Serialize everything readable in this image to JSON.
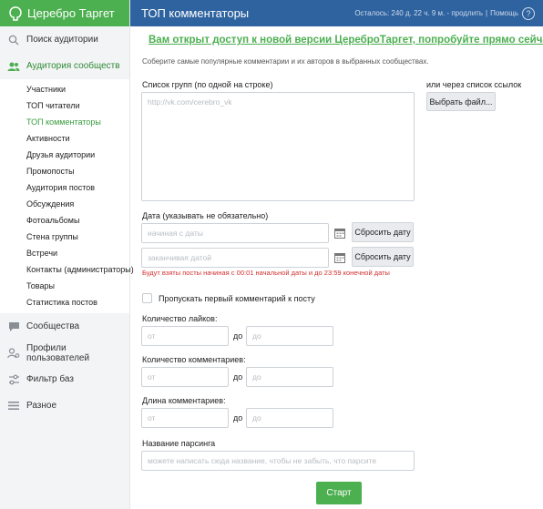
{
  "brand": {
    "name": "Церебро Таргет"
  },
  "topbar": {
    "title": "ТОП комментаторы",
    "status": "Осталось: 240 д. 22 ч. 9 м. - продлить",
    "help": "Помощь",
    "help_icon": "?"
  },
  "sidebar": {
    "search_audience": "Поиск аудитории",
    "community_audience": "Аудитория сообществ",
    "sub_items": [
      "Участники",
      "ТОП читатели",
      "ТОП комментаторы",
      "Активности",
      "Друзья аудитории",
      "Промопосты",
      "Аудитория постов",
      "Обсуждения",
      "Фотоальбомы",
      "Стена группы",
      "Встречи",
      "Контакты (администраторы)",
      "Товары",
      "Статистика постов"
    ],
    "communities": "Сообщества",
    "user_profiles": "Профили пользователей",
    "filter_bases": "Фильтр баз",
    "misc": "Разное"
  },
  "main": {
    "banner": "Вам открыт доступ к новой версии ЦереброТаргет, попробуйте прямо сейчас",
    "description": "Соберите самые популярные комментарии и их авторов в выбранных сообществах.",
    "groups_label": "Список групп (по одной на строке)",
    "groups_placeholder": "http://vk.com/cerebro_vk",
    "or_links_label": "или через список ссылок",
    "choose_file": "Выбрать файл...",
    "date_label": "Дата (указывать не обязательно)",
    "date_from_placeholder": "начиная с даты",
    "date_to_placeholder": "заканчивая датой",
    "reset_date": "Сбросить дату",
    "date_note": "Будут взяты посты начиная с 00:01 начальной даты и до 23:59 конечной даты",
    "skip_first": "Пропускать первый комментарий к посту",
    "likes_label": "Количество лайков:",
    "comments_label": "Количество комментариев:",
    "length_label": "Длина комментариев:",
    "from_placeholder": "от",
    "to_placeholder": "до",
    "to_text": "до",
    "parsing_name_label": "Название парсинга",
    "parsing_name_placeholder": "можете написать сюда название, чтобы не забыть, что парсите",
    "start": "Старт"
  },
  "colors": {
    "green": "#4caf50",
    "blue": "#2f63a0",
    "red": "#d32f2f"
  }
}
